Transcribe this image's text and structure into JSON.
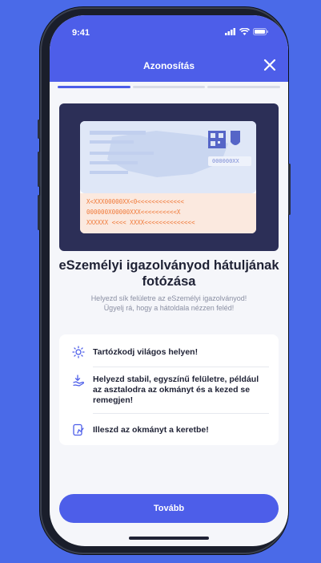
{
  "status_bar": {
    "time": "9:41"
  },
  "header": {
    "title": "Azonosítás",
    "close_icon": "close-icon"
  },
  "progress": {
    "steps": 3,
    "current": 1
  },
  "illustration": {
    "serial_text": "000000XX",
    "mrz_lines": [
      "X<XXX00000XX<0<<<<<<<<<<<<<",
      "000000X00000XXX<<<<<<<<<<X",
      "XXXXXX <<<< XXXX<<<<<<<<<<<<<<"
    ]
  },
  "main": {
    "heading": "eSzemélyi igazolványod hátuljának fotózása",
    "subtext_line1": "Helyezd sík felületre az eSzemélyi igazolványod!",
    "subtext_line2": "Ügyelj rá, hogy a hátoldala nézzen feléd!"
  },
  "tips": [
    {
      "icon": "sun-icon",
      "text": "Tartózkodj világos helyen!"
    },
    {
      "icon": "hand-card-icon",
      "text": "Helyezd stabil, egyszínű felületre, például az asztalodra az okmányt és a kezed se remegjen!"
    },
    {
      "icon": "frame-icon",
      "text": "Illeszd az okmányt a keretbe!"
    }
  ],
  "cta": {
    "label": "Tovább"
  },
  "colors": {
    "accent": "#4d5ee9",
    "panel": "#2c2f57",
    "mrz": "#f07a3a"
  }
}
